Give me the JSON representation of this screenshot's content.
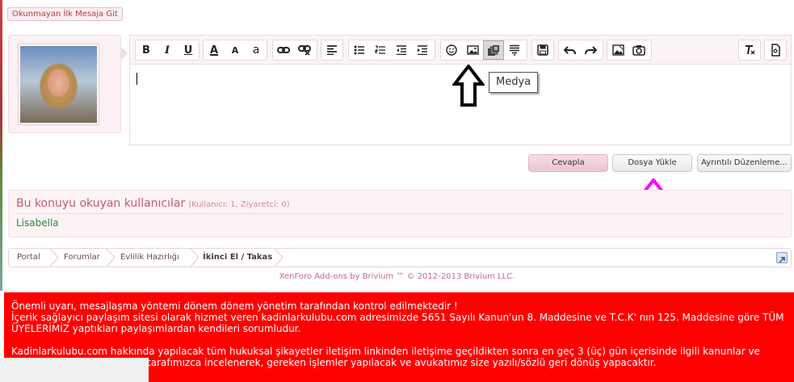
{
  "thread": {
    "unread_button_label": "Okunmayan İlk Mesaja Git"
  },
  "editor": {
    "toolbar_icons": [
      "bold-icon",
      "italic-icon",
      "underline-icon",
      "text-color-icon",
      "font-size-icon",
      "font-family-icon",
      "link-icon",
      "unlink-icon",
      "align-icon",
      "bullet-list-icon",
      "numbered-list-icon",
      "outdent-icon",
      "indent-icon",
      "smiley-icon",
      "image-icon",
      "media-icon",
      "code-icon",
      "save-draft-icon",
      "undo-icon",
      "redo-icon",
      "photo-icon",
      "camera-icon",
      "remove-format-icon",
      "toggle-bbcode-icon"
    ],
    "tooltip": "Medya",
    "bold_glyph": "B",
    "italic_glyph": "I",
    "underline_glyph": "U",
    "text_color_glyph": "A",
    "font_size_glyph": "A",
    "font_family_glyph": "a"
  },
  "actions": {
    "reply_label": "Cevapla",
    "upload_label": "Dosya Yükle",
    "advanced_label": "Ayrıntılı Düzenleme..."
  },
  "viewers": {
    "heading": "Bu konuyu okuyan kullanıcılar",
    "stats": "(Kullanıcı: 1, Ziyaretci: 0)",
    "names": [
      "Lisabella"
    ]
  },
  "breadcrumb": {
    "items": [
      "Portal",
      "Forumlar",
      "Evlilik Hazırlığı",
      "İkinci El / Takas"
    ]
  },
  "footer": {
    "credit": "XenForo Add-ons by Brivium ™ © 2012-2013 Brivium LLC."
  },
  "warning": {
    "line1": "Önemli uyarı, mesajlaşma yöntemi dönem dönem yönetim tarafından kontrol edilmektedir !",
    "line2": "İçerik sağlayıcı paylaşım sitesi olarak hizmet veren kadinlarkulubu.com adresimizde 5651 Sayılı Kanun'un 8. Maddesine ve T.C.K' nın 125. Maddesine göre TÜM",
    "line3": "ÜYELERİMİZ yaptıkları paylaşımlardan kendileri sorumludur.",
    "line4": "Kadinlarkulubu.com hakkında yapılacak tüm hukuksal şikayetler iletişim linkinden iletişime geçildikten sonra en geç 3 (üç) gün içerisinde ilgili kanunlar ve",
    "line5": "tarafımızca incelenerek, gereken işlemler yapılacak ve avukatımız size yazılı/sözlü geri dönüş yapacaktır."
  },
  "colors": {
    "warning_bg": "#ff0000",
    "accent_pink": "#c45a73",
    "viewer_green": "#2a8a3a",
    "annotation_arrow_magenta": "#ff00ff",
    "annotation_arrow_black": "#000000"
  }
}
